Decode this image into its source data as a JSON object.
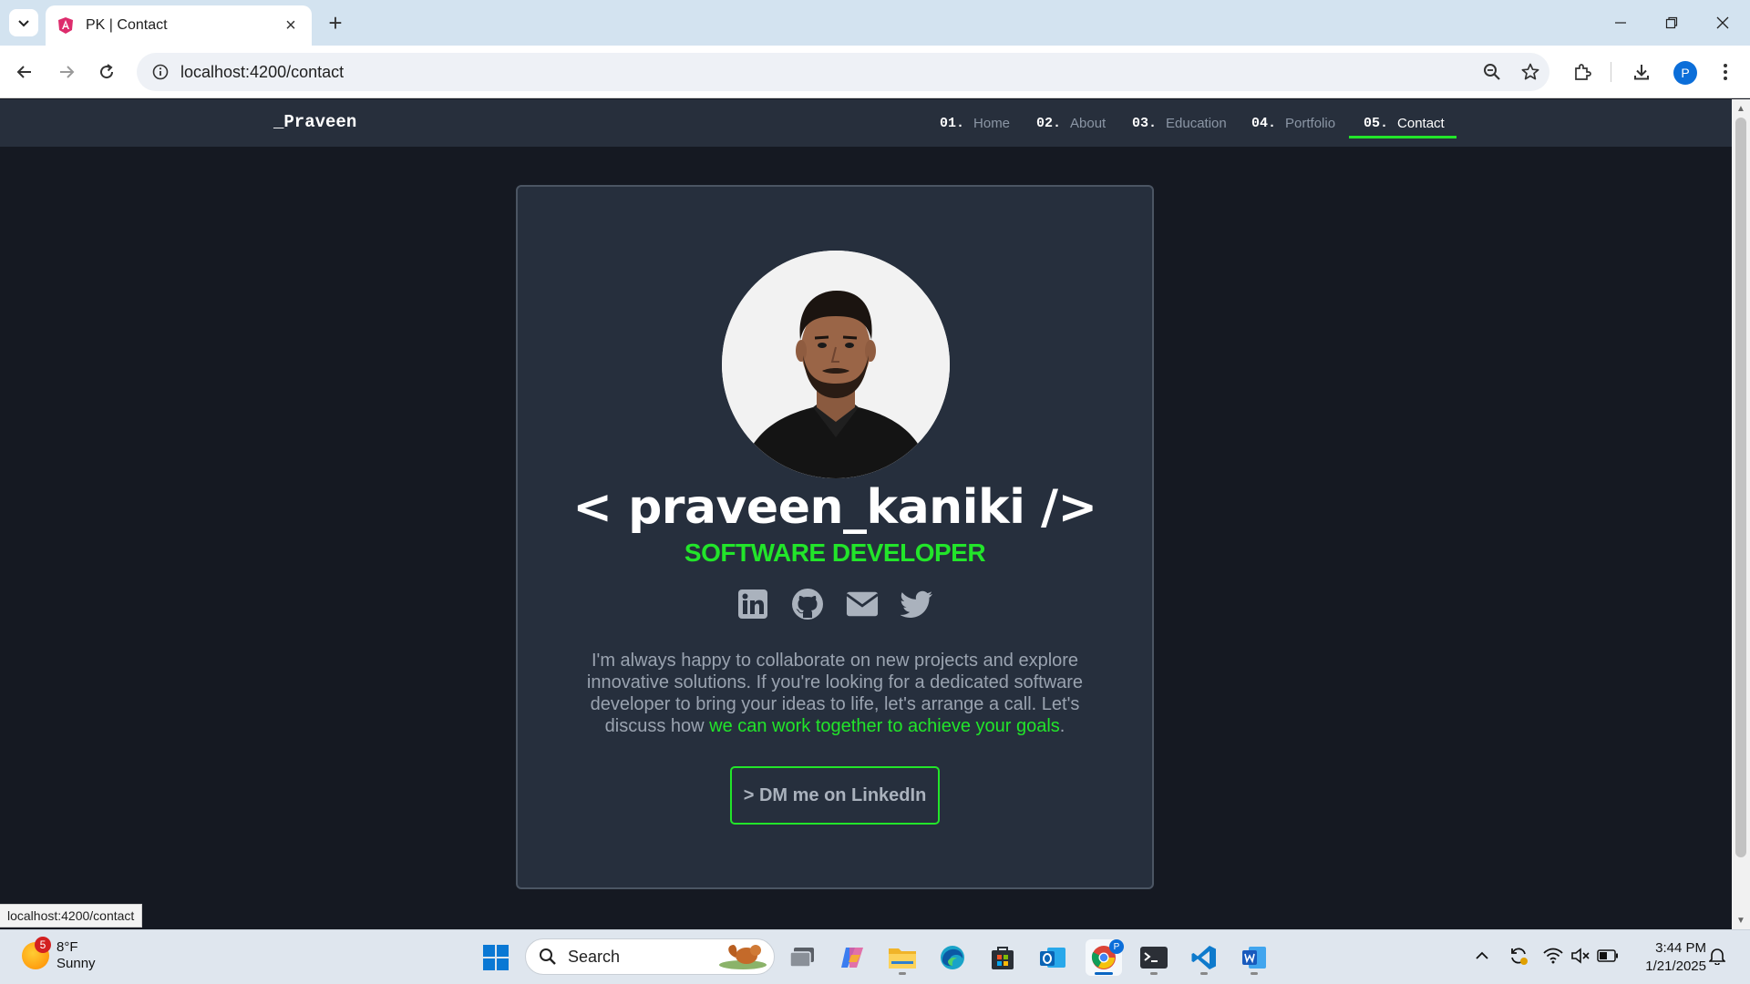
{
  "browser": {
    "tab_title": "PK | Contact",
    "url": "localhost:4200/contact",
    "profile_initial": "P",
    "status_url": "localhost:4200/contact"
  },
  "site": {
    "brand": "_Praveen",
    "nav": [
      {
        "num": "01.",
        "label": "Home"
      },
      {
        "num": "02.",
        "label": "About"
      },
      {
        "num": "03.",
        "label": "Education"
      },
      {
        "num": "04.",
        "label": "Portfolio"
      },
      {
        "num": "05.",
        "label": "Contact",
        "active": true
      }
    ]
  },
  "contact": {
    "name": "< praveen_kaniki />",
    "role": "SOFTWARE DEVELOPER",
    "social_icons": [
      "linkedin-icon",
      "github-icon",
      "email-icon",
      "twitter-icon"
    ],
    "bio_text": "I'm always happy to collaborate on new projects and explore innovative solutions. If you're looking for a dedicated software developer to bring your ideas to life, let's arrange a call. Let's discuss how ",
    "bio_highlight": "we can work together to achieve your goals",
    "bio_end": ".",
    "cta_label": "> DM me on LinkedIn"
  },
  "taskbar": {
    "weather_temp": "8°F",
    "weather_desc": "Sunny",
    "weather_badge": "5",
    "search_placeholder": "Search",
    "time": "3:44 PM",
    "date": "1/21/2025"
  },
  "colors": {
    "accent": "#22e52a",
    "page_bg": "#151922",
    "card_bg": "#262f3d",
    "nav_bg": "#272f3c"
  }
}
